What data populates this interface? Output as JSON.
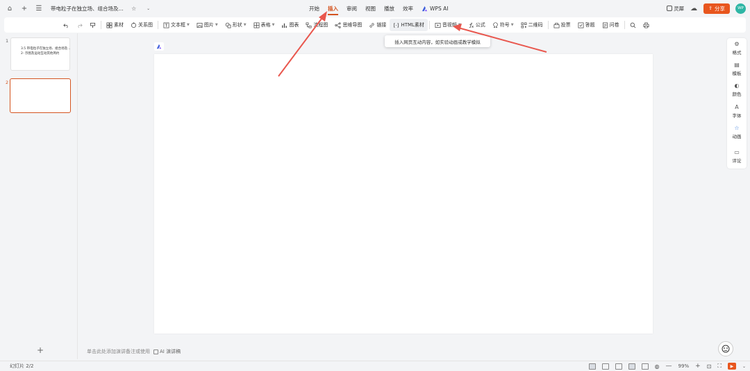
{
  "titlebar": {
    "doc_title": "带电粒子在独立场、组合场及...",
    "menu": [
      {
        "label": "开始",
        "active": false
      },
      {
        "label": "插入",
        "active": true
      },
      {
        "label": "审阅",
        "active": false
      },
      {
        "label": "视图",
        "active": false
      },
      {
        "label": "播放",
        "active": false
      },
      {
        "label": "效率",
        "active": false
      }
    ],
    "wps_ai": "WPS AI",
    "lingxi": "灵犀",
    "share": "分享",
    "avatar": "WP"
  },
  "toolbar": {
    "items": [
      "素材",
      "关系图",
      "文本框",
      "图片",
      "形状",
      "表格",
      "图表",
      "流程图",
      "思维导图",
      "链接",
      "HTML素材",
      "音视频",
      "公式",
      "符号",
      "二维码",
      "投票",
      "答题",
      "问卷"
    ]
  },
  "tooltip": "插入网页互动内容，如实验动画或教学模拟",
  "slides": {
    "numbers": [
      "1",
      "2"
    ],
    "thumb1_line1": "3.5 带电粒子在独立场、组合场及...",
    "thumb1_line2": "2-  示图及运动互动其他简约"
  },
  "notes": {
    "placeholder": "单击此处添加演讲备注或使用",
    "ai_notes": "AI 演讲稿"
  },
  "rightpanel": {
    "items": [
      "格式",
      "模板",
      "颜色",
      "字体",
      "动画",
      "评论"
    ]
  },
  "status": {
    "slide_count": "幻灯片 2/2",
    "zoom": "99%"
  },
  "colors": {
    "accent": "#d4541f",
    "share_bg": "#e8561e",
    "arrow": "#e9574e"
  }
}
